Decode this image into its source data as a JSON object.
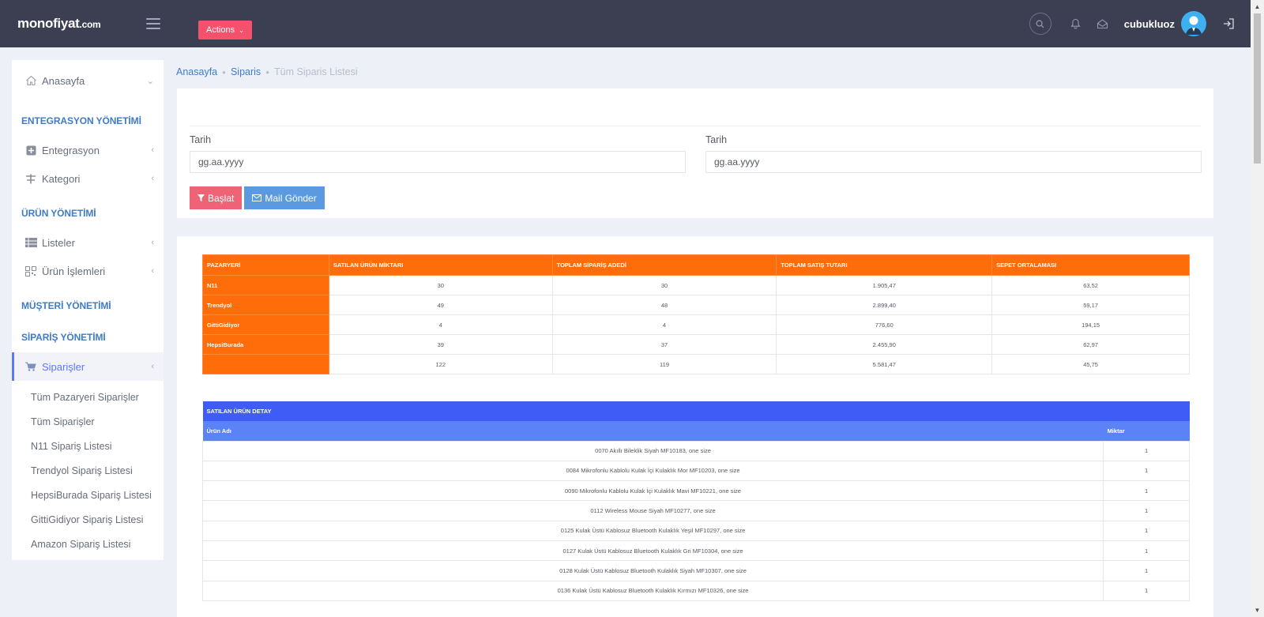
{
  "header": {
    "logo_main": "monofiyat",
    "logo_suffix": ".com",
    "actions_label": "Actions",
    "username": "cubukluoz"
  },
  "sidebar": {
    "home": "Anasayfa",
    "sections": {
      "entegrasyon": "ENTEGRASYON YÖNETİMİ",
      "urun": "ÜRÜN YÖNETİMİ",
      "musteri": "MÜŞTERİ YÖNETİMİ",
      "siparis": "SİPARİŞ YÖNETİMİ"
    },
    "items": {
      "entegrasyon": "Entegrasyon",
      "kategori": "Kategori",
      "listeler": "Listeler",
      "urun_islemleri": "Ürün İşlemleri",
      "siparisler": "Siparişler"
    },
    "subitems": [
      "Tüm Pazaryeri Siparişler",
      "Tüm Siparişler",
      "N11 Sipariş Listesi",
      "Trendyol Sipariş Listesi",
      "HepsiBurada Sipariş Listesi",
      "GittiGidiyor Sipariş Listesi",
      "Amazon Sipariş Listesi"
    ]
  },
  "breadcrumb": {
    "home": "Anasayfa",
    "parent": "Siparis",
    "current": "Tüm Siparis Listesi"
  },
  "filter": {
    "date_label_1": "Tarih",
    "date_label_2": "Tarih",
    "date_placeholder": "gg.aa.yyyy",
    "start_button": "Başlat",
    "mail_button": "Mail Gönder"
  },
  "summary": {
    "headers": [
      "PAZARYERİ",
      "SATILAN ÜRÜN MİKTARI",
      "TOPLAM SİPARİŞ ADEDİ",
      "TOPLAM SATIŞ TUTARI",
      "SEPET ORTALAMASI"
    ],
    "rows": [
      [
        "N11",
        "30",
        "30",
        "1.905,47",
        "63,52"
      ],
      [
        "Trendyol",
        "49",
        "48",
        "2.899,40",
        "59,17"
      ],
      [
        "GittiGidiyor",
        "4",
        "4",
        "776,60",
        "194,15"
      ],
      [
        "HepsiBurada",
        "39",
        "37",
        "2.455,90",
        "62,97"
      ],
      [
        "",
        "122",
        "119",
        "5.581,47",
        "45,75"
      ]
    ]
  },
  "detail": {
    "title": "SATILAN ÜRÜN DETAY",
    "col_name": "Ürün Adı",
    "col_qty": "Miktar",
    "rows": [
      [
        "0070 Akıllı Bileklik Siyah MF10183, one size",
        "1"
      ],
      [
        "0084 Mikrofonlu Kablolu Kulak İçi Kulaklık Mor MF10203, one size",
        "1"
      ],
      [
        "0090 Mikrofonlu Kablolu Kulak İçi Kulaklık Mavi MF10221, one size",
        "1"
      ],
      [
        "0112 Wireless Mouse Siyah MF10277, one size",
        "1"
      ],
      [
        "0125 Kulak Üstü Kablosuz Bluetooth Kulaklık Yeşil MF10297, one size",
        "1"
      ],
      [
        "0127 Kulak Üstü Kablosuz Bluetooth Kulaklık Gri MF10304, one size",
        "1"
      ],
      [
        "0128 Kulak Üstü Kablosuz Bluetooth Kulaklık Siyah MF10307, one size",
        "1"
      ],
      [
        "0136 Kulak Üstü Kablosuz Bluetooth Kulaklık Kırmızı MF10326, one size",
        "1"
      ]
    ]
  },
  "colors": {
    "header_bg": "#3c3e52",
    "actions_bg": "#f4516c",
    "summary_orange": "#ff6c0a",
    "detail_blue": "#3f5cf6",
    "link_blue": "#3f7bc7"
  }
}
